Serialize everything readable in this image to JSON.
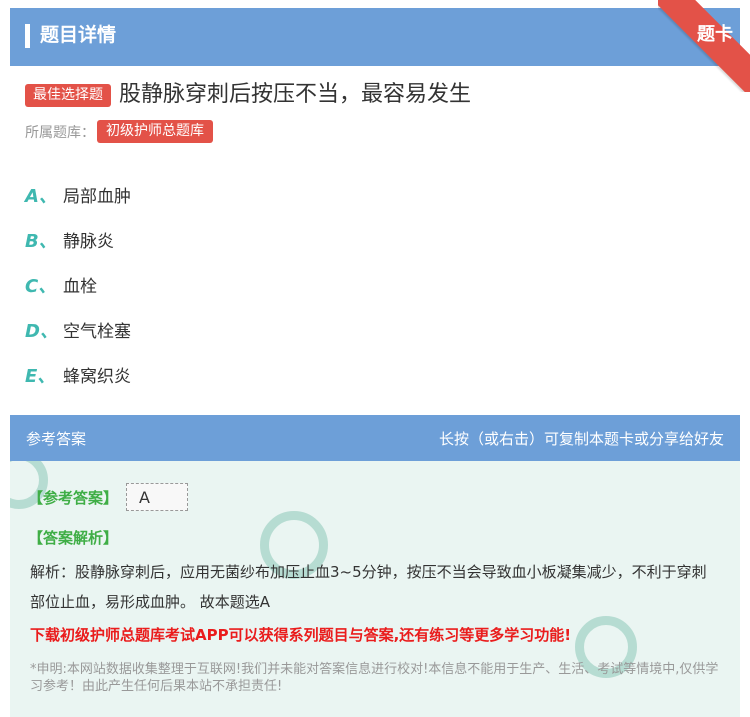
{
  "header": {
    "title": "题目详情",
    "ribbon": "题卡"
  },
  "question": {
    "type_badge": "最佳选择题",
    "text": "股静脉穿刺后按压不当，最容易发生",
    "bank_label": "所属题库：",
    "bank_name": "初级护师总题库",
    "options": [
      {
        "letter": "A、",
        "text": "局部血肿"
      },
      {
        "letter": "B、",
        "text": "静脉炎"
      },
      {
        "letter": "C、",
        "text": "血栓"
      },
      {
        "letter": "D、",
        "text": "空气栓塞"
      },
      {
        "letter": "E、",
        "text": "蜂窝织炎"
      }
    ]
  },
  "answer": {
    "head_left": "参考答案",
    "head_right": "长按（或右击）可复制本题卡或分享给好友",
    "answer_label": "【参考答案】",
    "answer_value": "A",
    "analysis_label": "【答案解析】",
    "analysis_text": "解析：股静脉穿刺后，应用无菌纱布加压止血3~5分钟，按压不当会导致血小板凝集减少，不利于穿刺部位止血，易形成血肿。 故本题选A",
    "promo": "下载初级护师总题库考试APP可以获得系列题目与答案,还有练习等更多学习功能!",
    "disclaimer": "*申明:本网站数据收集整理于互联网!我们并未能对答案信息进行校对!本信息不能用于生产、生活、考试等情境中,仅供学习参考！由此产生任何后果本站不承担责任!"
  },
  "colors": {
    "header_bg": "#6d9fd8",
    "accent_red": "#e35248",
    "option_letter": "#3fb8b0",
    "green_label": "#3fae46",
    "promo_red": "#ea1c1c",
    "answer_bg": "#eaf5f2"
  }
}
